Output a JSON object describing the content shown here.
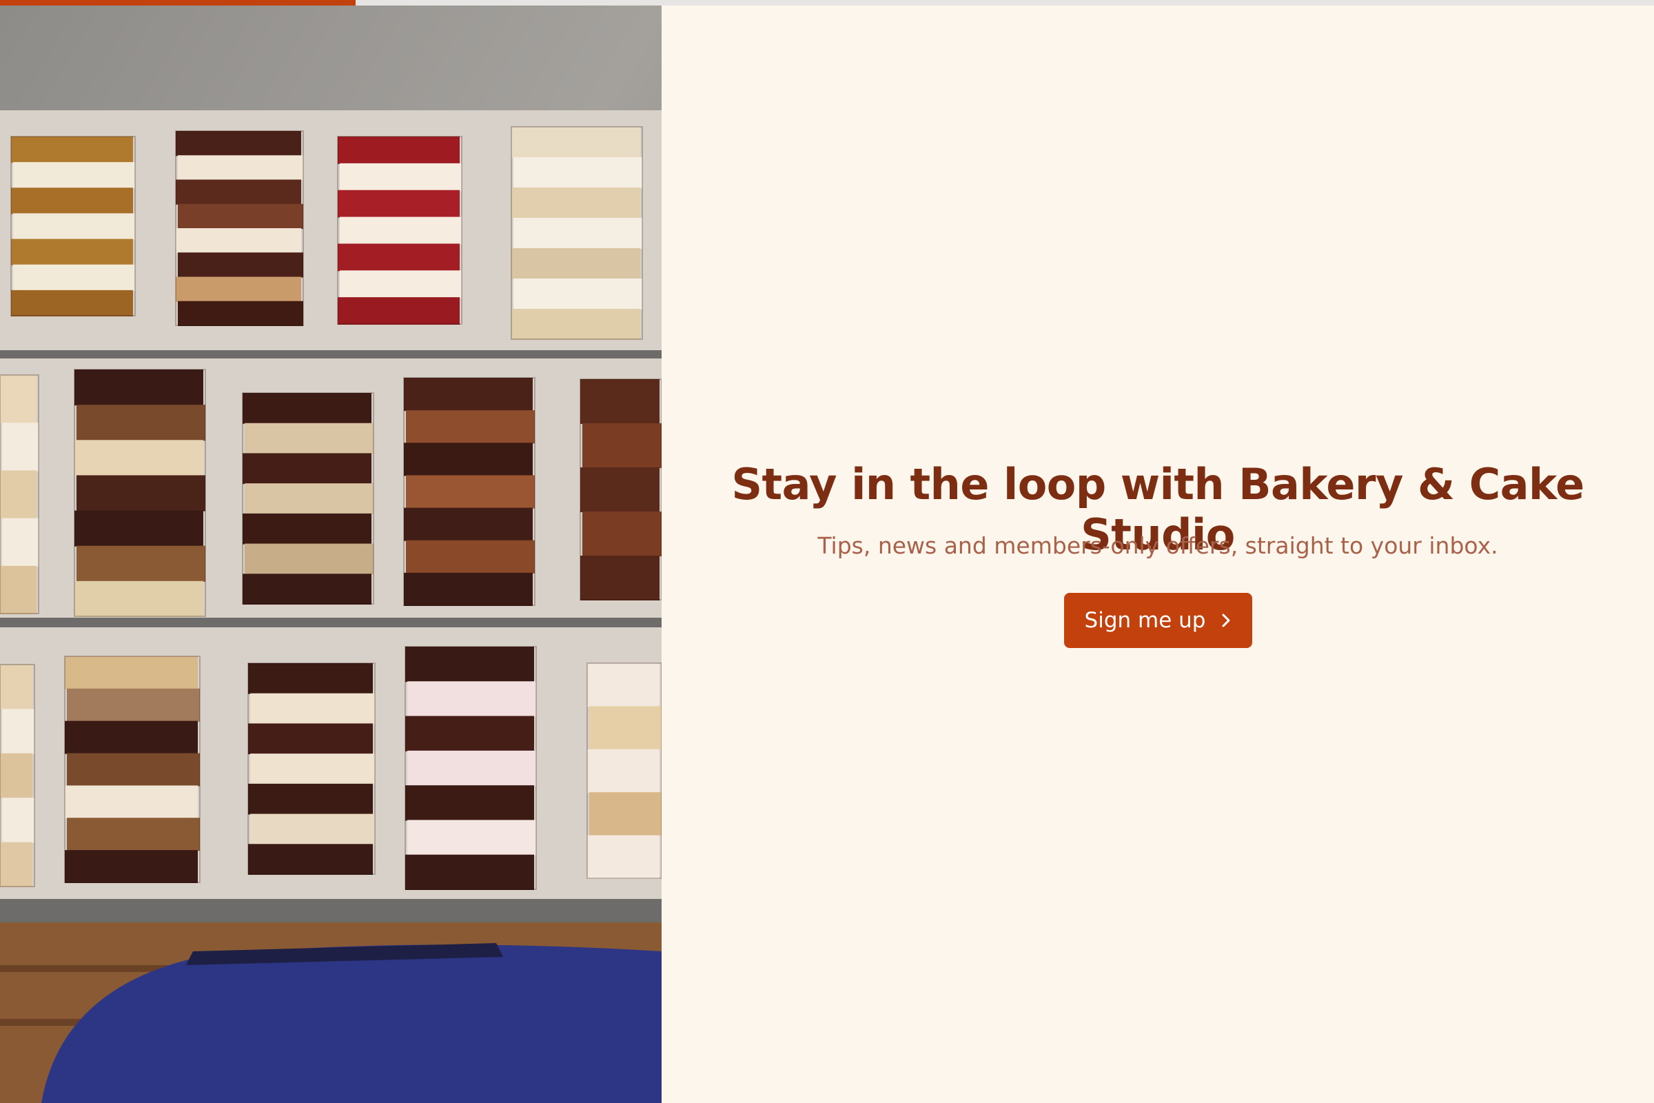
{
  "progress": {
    "fraction": 0.215,
    "color": "#c2410c"
  },
  "hero_image": {
    "alt": "Assorted layered cake slices on trays"
  },
  "newsletter": {
    "headline": "Stay in the loop with Bakery & Cake Studio",
    "subtext": "Tips, news and members-only offers, straight to your inbox.",
    "cta_label": "Sign me up",
    "cta_icon": "chevron-right-icon"
  },
  "colors": {
    "background": "#fdf6ec",
    "headline": "#7c2d12",
    "subtext": "#a8624a",
    "accent": "#c2410c"
  }
}
